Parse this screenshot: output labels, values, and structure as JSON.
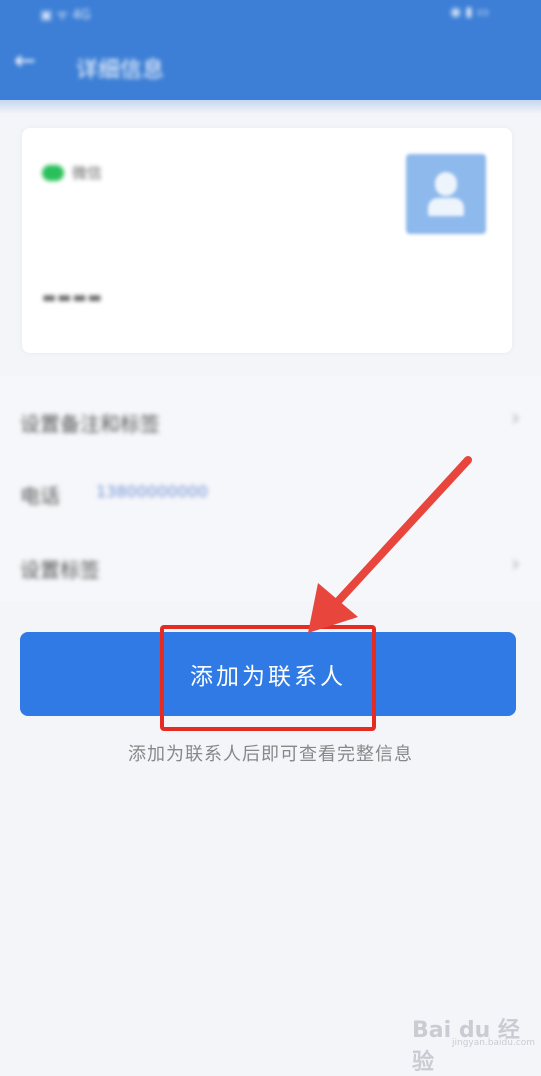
{
  "status_bar": {
    "left": "▣ ᯤ 4G",
    "right": "◉ ▮ ▭"
  },
  "app_bar": {
    "back_icon": "arrow-left-icon",
    "back_glyph": "←",
    "title": "详细信息"
  },
  "card": {
    "brand_icon": "wechat-icon",
    "brand_name": "微信",
    "nickname": "▬▬▬▬",
    "avatar_icon": "person-icon"
  },
  "rows": [
    {
      "label": "设置备注和标签",
      "value": "",
      "chevron": "›"
    },
    {
      "label": "电话",
      "value": "13800000000",
      "chevron": ""
    },
    {
      "label": "设置标签",
      "value": "",
      "chevron": "›"
    }
  ],
  "action": {
    "button_label": "添加为联系人",
    "hint": "添加为联系人后即可查看完整信息"
  },
  "annotation": {
    "box_color": "#e52b22",
    "arrow_color": "#e8453c"
  },
  "watermark": {
    "text": "Bai du 经验",
    "sub": "jingyan.baidu.com"
  },
  "colors": {
    "primary": "#2f7ae5",
    "header": "#3d7fd6",
    "background": "#f3f5f9"
  }
}
